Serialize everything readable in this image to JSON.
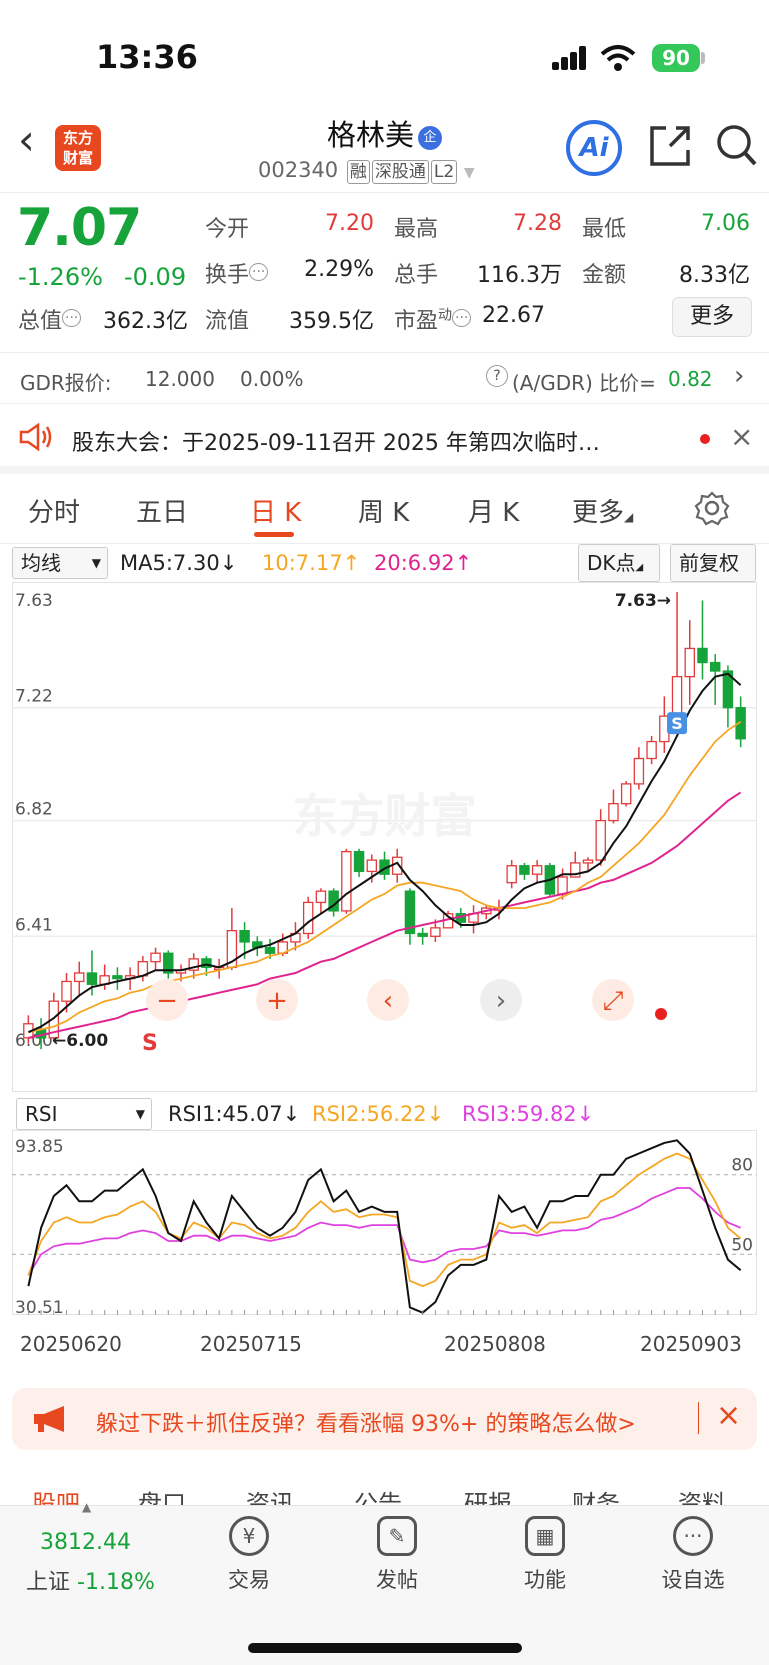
{
  "status": {
    "time": "13:36",
    "battery": "90"
  },
  "header": {
    "logo": "东方\n财富",
    "name": "格林美",
    "badge": "企",
    "code": "002340",
    "tags": [
      "融",
      "深股通",
      "L2"
    ],
    "ai": "Ai"
  },
  "quote": {
    "price": "7.07",
    "change_pct": "-1.26%",
    "change": "-0.09",
    "fields": [
      {
        "label": "今开",
        "value": "7.20",
        "color": "red"
      },
      {
        "label": "最高",
        "value": "7.28",
        "color": "red"
      },
      {
        "label": "最低",
        "value": "7.06",
        "color": "green"
      },
      {
        "label": "换手",
        "value": "2.29%",
        "color": "black"
      },
      {
        "label": "总手",
        "value": "116.3万",
        "color": "black"
      },
      {
        "label": "金额",
        "value": "8.33亿",
        "color": "black"
      },
      {
        "label": "总值",
        "value": "362.3亿",
        "color": "black"
      },
      {
        "label": "流值",
        "value": "359.5亿",
        "color": "black"
      },
      {
        "label": "市盈",
        "value": "22.67",
        "color": "black"
      }
    ],
    "pe_sup": "动",
    "more": "更多"
  },
  "gdr": {
    "label": "GDR报价:",
    "price": "12.000",
    "pct": "0.00%",
    "ratio_label": "(A/GDR) 比价=",
    "ratio": "0.82"
  },
  "notice": {
    "text": "股东大会：于2025-09-11召开 2025 年第四次临时…"
  },
  "tabs": [
    "分时",
    "五日",
    "日 K",
    "周 K",
    "月 K",
    "更多"
  ],
  "ma": {
    "select": "均线",
    "ma5": "MA5:7.30",
    "ma10": "10:7.17",
    "ma20": "20:6.92",
    "dk": "DK点",
    "fq": "前复权"
  },
  "rsi_row": {
    "select": "RSI",
    "rsi1": "RSI1:45.07",
    "rsi2": "RSI2:56.22",
    "rsi3": "RSI3:59.82"
  },
  "chart_data": [
    {
      "type": "candlestick",
      "y_ticks": [
        "7.63",
        "7.22",
        "6.82",
        "6.41",
        "6.00"
      ],
      "ylim": [
        6.0,
        7.63
      ],
      "high_label": "7.63",
      "low_label": "6.00",
      "watermark": "东方财富",
      "candles": [
        [
          6.05,
          6.1,
          6.03,
          6.13
        ],
        [
          6.08,
          6.05,
          6.01,
          6.12
        ],
        [
          6.05,
          6.18,
          6.04,
          6.21
        ],
        [
          6.18,
          6.25,
          6.14,
          6.28
        ],
        [
          6.25,
          6.28,
          6.2,
          6.32
        ],
        [
          6.28,
          6.24,
          6.2,
          6.36
        ],
        [
          6.24,
          6.27,
          6.22,
          6.31
        ],
        [
          6.27,
          6.26,
          6.22,
          6.3
        ],
        [
          6.26,
          6.27,
          6.22,
          6.3
        ],
        [
          6.27,
          6.32,
          6.25,
          6.34
        ],
        [
          6.32,
          6.35,
          6.29,
          6.37
        ],
        [
          6.35,
          6.28,
          6.26,
          6.36
        ],
        [
          6.28,
          6.29,
          6.25,
          6.31
        ],
        [
          6.29,
          6.33,
          6.26,
          6.35
        ],
        [
          6.33,
          6.3,
          6.27,
          6.34
        ],
        [
          6.3,
          6.3,
          6.26,
          6.33
        ],
        [
          6.3,
          6.43,
          6.29,
          6.51
        ],
        [
          6.43,
          6.39,
          6.33,
          6.46
        ],
        [
          6.39,
          6.37,
          6.34,
          6.41
        ],
        [
          6.37,
          6.35,
          6.33,
          6.4
        ],
        [
          6.35,
          6.39,
          6.34,
          6.42
        ],
        [
          6.39,
          6.42,
          6.36,
          6.46
        ],
        [
          6.42,
          6.53,
          6.4,
          6.55
        ],
        [
          6.53,
          6.57,
          6.49,
          6.58
        ],
        [
          6.57,
          6.5,
          6.48,
          6.58
        ],
        [
          6.5,
          6.71,
          6.49,
          6.72
        ],
        [
          6.71,
          6.64,
          6.62,
          6.72
        ],
        [
          6.64,
          6.68,
          6.6,
          6.7
        ],
        [
          6.68,
          6.63,
          6.61,
          6.71
        ],
        [
          6.63,
          6.69,
          6.6,
          6.72
        ],
        [
          6.57,
          6.42,
          6.38,
          6.58
        ],
        [
          6.42,
          6.41,
          6.38,
          6.44
        ],
        [
          6.41,
          6.44,
          6.39,
          6.47
        ],
        [
          6.44,
          6.49,
          6.44,
          6.5
        ],
        [
          6.49,
          6.46,
          6.44,
          6.51
        ],
        [
          6.46,
          6.49,
          6.42,
          6.52
        ],
        [
          6.49,
          6.51,
          6.47,
          6.52
        ],
        [
          6.51,
          6.51,
          6.47,
          6.54
        ],
        [
          6.6,
          6.66,
          6.58,
          6.68
        ],
        [
          6.66,
          6.63,
          6.61,
          6.67
        ],
        [
          6.63,
          6.66,
          6.6,
          6.68
        ],
        [
          6.66,
          6.56,
          6.55,
          6.67
        ],
        [
          6.56,
          6.62,
          6.54,
          6.65
        ],
        [
          6.62,
          6.67,
          6.62,
          6.71
        ],
        [
          6.67,
          6.68,
          6.64,
          6.69
        ],
        [
          6.68,
          6.82,
          6.66,
          6.86
        ],
        [
          6.82,
          6.88,
          6.81,
          6.93
        ],
        [
          6.88,
          6.95,
          6.87,
          6.96
        ],
        [
          6.95,
          7.04,
          6.93,
          7.08
        ],
        [
          7.04,
          7.1,
          7.02,
          7.12
        ],
        [
          7.1,
          7.19,
          7.06,
          7.26
        ],
        [
          7.19,
          7.33,
          7.13,
          7.63
        ],
        [
          7.33,
          7.43,
          7.23,
          7.53
        ],
        [
          7.43,
          7.38,
          7.32,
          7.6
        ],
        [
          7.38,
          7.35,
          7.23,
          7.41
        ],
        [
          7.35,
          7.22,
          7.15,
          7.37
        ],
        [
          7.22,
          7.11,
          7.08,
          7.26
        ]
      ],
      "ma5": [
        6.07,
        6.09,
        6.12,
        6.16,
        6.2,
        6.23,
        6.24,
        6.25,
        6.26,
        6.27,
        6.29,
        6.29,
        6.29,
        6.3,
        6.31,
        6.3,
        6.32,
        6.35,
        6.37,
        6.38,
        6.4,
        6.42,
        6.46,
        6.49,
        6.52,
        6.56,
        6.59,
        6.62,
        6.65,
        6.67,
        6.61,
        6.57,
        6.52,
        6.48,
        6.45,
        6.45,
        6.46,
        6.49,
        6.54,
        6.58,
        6.6,
        6.61,
        6.63,
        6.63,
        6.64,
        6.67,
        6.74,
        6.8,
        6.88,
        6.96,
        7.03,
        7.12,
        7.21,
        7.28,
        7.33,
        7.34,
        7.3
      ],
      "ma10": [
        6.07,
        6.08,
        6.09,
        6.11,
        6.14,
        6.16,
        6.18,
        6.19,
        6.21,
        6.22,
        6.24,
        6.25,
        6.26,
        6.27,
        6.28,
        6.29,
        6.3,
        6.31,
        6.32,
        6.34,
        6.35,
        6.37,
        6.39,
        6.42,
        6.45,
        6.48,
        6.51,
        6.54,
        6.56,
        6.59,
        6.6,
        6.6,
        6.59,
        6.58,
        6.57,
        6.54,
        6.52,
        6.51,
        6.51,
        6.51,
        6.52,
        6.53,
        6.55,
        6.57,
        6.6,
        6.62,
        6.66,
        6.7,
        6.74,
        6.79,
        6.84,
        6.91,
        6.98,
        7.04,
        7.1,
        7.14,
        7.17
      ],
      "ma20": [
        6.05,
        6.06,
        6.07,
        6.08,
        6.09,
        6.1,
        6.11,
        6.12,
        6.14,
        6.15,
        6.16,
        6.17,
        6.18,
        6.19,
        6.2,
        6.21,
        6.22,
        6.23,
        6.24,
        6.26,
        6.27,
        6.28,
        6.3,
        6.32,
        6.33,
        6.35,
        6.37,
        6.39,
        6.41,
        6.43,
        6.44,
        6.45,
        6.46,
        6.47,
        6.48,
        6.49,
        6.5,
        6.51,
        6.52,
        6.53,
        6.54,
        6.55,
        6.56,
        6.57,
        6.58,
        6.6,
        6.61,
        6.63,
        6.65,
        6.67,
        6.7,
        6.73,
        6.77,
        6.81,
        6.85,
        6.89,
        6.92
      ]
    },
    {
      "type": "line",
      "name": "RSI",
      "y_ticks": [
        "93.85",
        "30.51"
      ],
      "ylim": [
        30.51,
        93.85
      ],
      "ref_lines": [
        "80",
        "50"
      ],
      "rsi1": [
        38,
        60,
        72,
        76,
        70,
        70,
        74,
        74,
        78,
        82,
        72,
        58,
        55,
        70,
        62,
        56,
        72,
        66,
        60,
        57,
        60,
        66,
        78,
        82,
        70,
        74,
        66,
        68,
        66,
        66,
        30,
        28,
        32,
        42,
        46,
        46,
        48,
        72,
        66,
        68,
        60,
        70,
        70,
        72,
        72,
        80,
        80,
        86,
        88,
        90,
        92,
        93,
        88,
        74,
        60,
        48,
        44
      ],
      "rsi2": [
        42,
        55,
        62,
        64,
        62,
        62,
        64,
        65,
        68,
        70,
        66,
        58,
        56,
        62,
        60,
        56,
        62,
        61,
        58,
        56,
        57,
        60,
        66,
        70,
        66,
        67,
        64,
        65,
        65,
        64,
        40,
        38,
        40,
        46,
        48,
        48,
        50,
        62,
        60,
        61,
        58,
        62,
        62,
        63,
        64,
        70,
        72,
        76,
        80,
        83,
        86,
        88,
        86,
        78,
        70,
        60,
        56
      ],
      "rsi3": [
        42,
        50,
        53,
        54,
        54,
        55,
        56,
        56,
        58,
        59,
        58,
        55,
        55,
        57,
        57,
        55,
        57,
        57,
        56,
        55,
        56,
        57,
        60,
        62,
        61,
        61,
        60,
        61,
        61,
        61,
        48,
        47,
        48,
        51,
        52,
        52,
        53,
        59,
        58,
        58,
        57,
        58,
        59,
        59,
        60,
        63,
        64,
        66,
        68,
        71,
        73,
        75,
        75,
        71,
        66,
        62,
        60
      ]
    }
  ],
  "dates": [
    "20250620",
    "20250715",
    "20250808",
    "20250903"
  ],
  "promo": {
    "text": "躲过下跌＋抓住反弹？看看涨幅 93%+ 的策略怎么做>"
  },
  "subtabs": [
    "股吧",
    "盘口",
    "资讯",
    "公告",
    "研报",
    "财务",
    "资料"
  ],
  "bottom": {
    "index_value": "3812.44",
    "index_name": "上证",
    "index_change": "-1.18%",
    "nav": [
      {
        "label": "交易",
        "icon": "¥"
      },
      {
        "label": "发帖",
        "icon": "✎"
      },
      {
        "label": "功能",
        "icon": "▦"
      },
      {
        "label": "设自选",
        "icon": "···"
      }
    ]
  },
  "colors": {
    "up": "#e23b3b",
    "down": "#16a33a",
    "ma5": "#111111",
    "ma10": "#f5a623",
    "ma20": "#e0238f",
    "accent": "#e8481f",
    "rsi3": "#e040e0"
  }
}
